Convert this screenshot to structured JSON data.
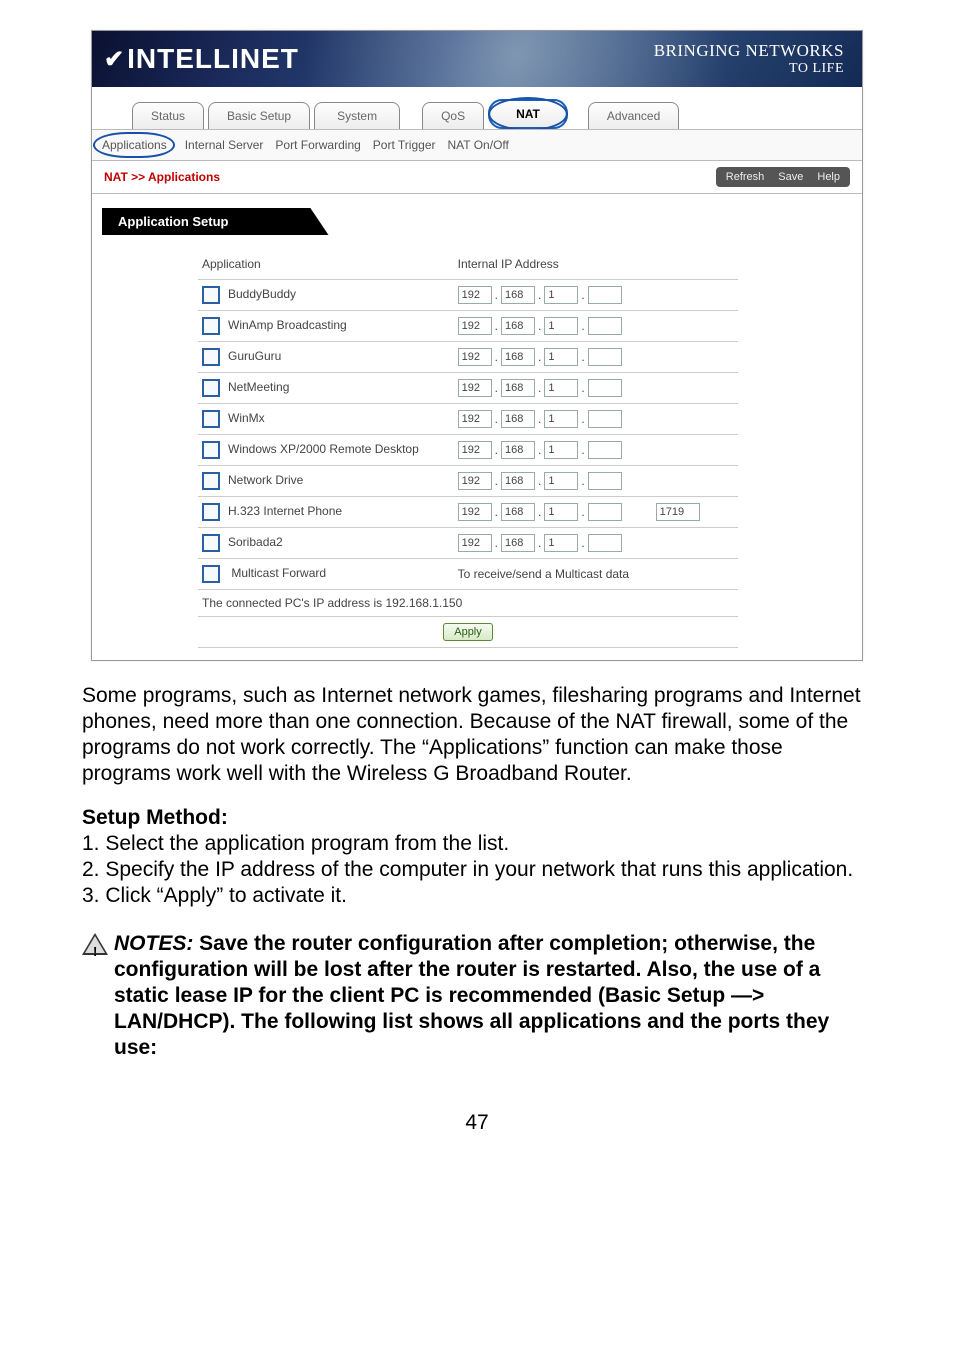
{
  "banner": {
    "logo": "INTELLINET",
    "slogan_line1": "BRINGING NETWORKS",
    "slogan_line2": "TO LIFE"
  },
  "tabs": {
    "status": "Status",
    "basic_setup": "Basic Setup",
    "system": "System",
    "qos": "QoS",
    "nat": "NAT",
    "advanced": "Advanced"
  },
  "subtabs": {
    "applications": "Applications",
    "internal_server": "Internal Server",
    "port_forwarding": "Port Forwarding",
    "port_trigger": "Port Trigger",
    "nat_onoff": "NAT On/Off"
  },
  "breadcrumb": "NAT >> Applications",
  "actions": {
    "refresh": "Refresh",
    "save": "Save",
    "help": "Help"
  },
  "section_title": "Application Setup",
  "table": {
    "col_app": "Application",
    "col_ip": "Internal IP Address",
    "rows": [
      {
        "name": "BuddyBuddy",
        "ip": [
          "192",
          "168",
          "1",
          ""
        ],
        "extra": ""
      },
      {
        "name": "WinAmp Broadcasting",
        "ip": [
          "192",
          "168",
          "1",
          ""
        ],
        "extra": ""
      },
      {
        "name": "GuruGuru",
        "ip": [
          "192",
          "168",
          "1",
          ""
        ],
        "extra": ""
      },
      {
        "name": "NetMeeting",
        "ip": [
          "192",
          "168",
          "1",
          ""
        ],
        "extra": ""
      },
      {
        "name": "WinMx",
        "ip": [
          "192",
          "168",
          "1",
          ""
        ],
        "extra": ""
      },
      {
        "name": "Windows XP/2000 Remote Desktop",
        "ip": [
          "192",
          "168",
          "1",
          ""
        ],
        "extra": ""
      },
      {
        "name": "Network Drive",
        "ip": [
          "192",
          "168",
          "1",
          ""
        ],
        "extra": ""
      },
      {
        "name": "H.323 Internet Phone",
        "ip": [
          "192",
          "168",
          "1",
          ""
        ],
        "extra": "1719"
      },
      {
        "name": "Soribada2",
        "ip": [
          "192",
          "168",
          "1",
          ""
        ],
        "extra": ""
      }
    ],
    "multicast": {
      "label": "Multicast Forward",
      "desc": "To receive/send a Multicast data"
    },
    "connected_note": "The connected PC's IP address is 192.168.1.150",
    "apply": "Apply"
  },
  "doc": {
    "intro": "Some programs, such as Internet network games, filesharing programs and Internet phones, need more than one connection. Because of the NAT firewall, some of the programs do not work correctly. The “Applications” function can make those programs work well with the Wireless G Broadband Router.",
    "setup_heading": "Setup Method:",
    "step1": "1. Select the application program from the list.",
    "step2": "2. Specify the IP address of the computer in your network that runs this application.",
    "step3": "3. Click “Apply” to activate it.",
    "notes_label": "NOTES:",
    "notes_body": " Save the router configuration after completion; otherwise, the configuration will be lost after the router is restarted. Also, the use of a static lease IP for the client PC is recommended (Basic Setup —> LAN/DHCP). The following list shows all applications and the ports they use:",
    "page_number": "47"
  }
}
